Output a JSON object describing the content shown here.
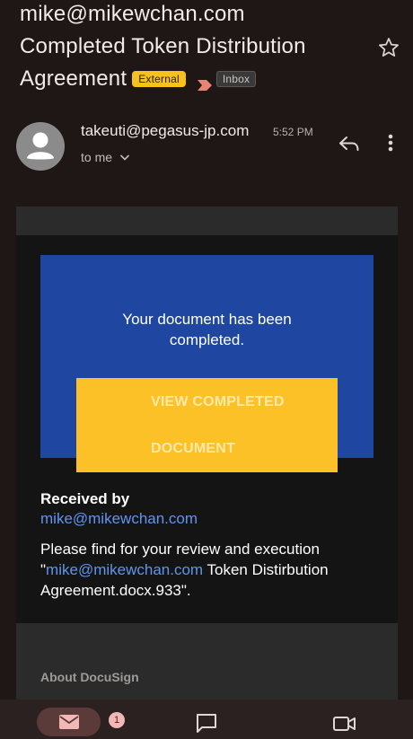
{
  "header": {
    "subject_line1": "mike@mikewchan.com",
    "subject_line2": "Completed Token Distribution",
    "subject_line3": "Agreement",
    "external_label": "External",
    "inbox_label": "Inbox",
    "star_icon": "star-outline-icon"
  },
  "message": {
    "sender": "takeuti@pegasus-jp.com",
    "time": "5:52 PM",
    "to_me": "to me",
    "avatar_icon": "person-icon",
    "reply_icon": "reply-icon",
    "more_icon": "more-vert-icon"
  },
  "email_body": {
    "panel_line1": "Your document has been",
    "panel_line2": "completed.",
    "button_line1": "VIEW COMPLETED",
    "button_line2": "DOCUMENT",
    "received_label": "Received by",
    "received_email": "mike@mikewchan.com",
    "body_text_pre": "Please find for your review and execution \"",
    "body_link": "mike@mikewchan.com",
    "body_text_post": " Token Distirbution Agreement.docx.933\".",
    "about_label": "About DocuSign"
  },
  "bottom_nav": {
    "mail_badge": "1",
    "mail_icon": "mail-icon",
    "chat_icon": "chat-icon",
    "meet_icon": "video-camera-icon"
  },
  "colors": {
    "background": "#1e1716",
    "external_badge": "#f7c21b",
    "panel_blue": "#1f47a1",
    "button_yellow": "#fcc127",
    "link_blue": "#5f95ee",
    "mail_pill": "#5a3b39",
    "badge_pink": "#f2b8b5"
  }
}
